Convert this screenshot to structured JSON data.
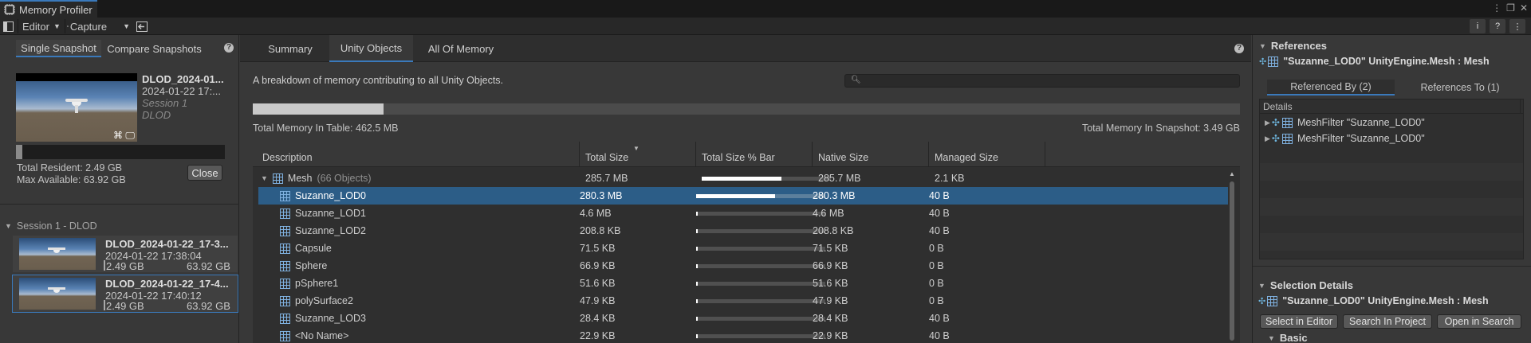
{
  "window": {
    "title": "Memory Profiler"
  },
  "toolbar": {
    "editor_label": "Editor",
    "capture_label": "Capture"
  },
  "left": {
    "tabs": [
      "Single Snapshot",
      "Compare Snapshots"
    ],
    "current": {
      "name": "DLOD_2024-01...",
      "date": "2024-01-22 17:...",
      "session": "Session 1",
      "project": "DLOD"
    },
    "total_resident": "Total Resident: 2.49 GB",
    "max_available": "Max Available: 63.92 GB",
    "close_label": "Close",
    "session_header": "Session 1 - DLOD",
    "snapshots": [
      {
        "name": "DLOD_2024-01-22_17-3...",
        "date": "2024-01-22 17:38:04",
        "resident": "2.49 GB",
        "max": "63.92 GB",
        "selected": false
      },
      {
        "name": "DLOD_2024-01-22_17-4...",
        "date": "2024-01-22 17:40:12",
        "resident": "2.49 GB",
        "max": "63.92 GB",
        "selected": true
      }
    ]
  },
  "center": {
    "tabs": [
      "Summary",
      "Unity Objects",
      "All Of Memory"
    ],
    "active_tab": "Unity Objects",
    "description": "A breakdown of memory contributing to all Unity Objects.",
    "search_placeholder": "",
    "total_in_table": "Total Memory In Table: 462.5 MB",
    "total_in_snapshot": "Total Memory In Snapshot: 3.49 GB",
    "table_fraction": 0.1325,
    "columns": [
      "Description",
      "Total Size",
      "Total Size % Bar",
      "Native Size",
      "Managed Size"
    ],
    "group": {
      "name": "Mesh",
      "count": "(66 Objects)",
      "total": "285.7 MB",
      "bar": 0.62,
      "native": "285.7 MB",
      "managed": "2.1 KB"
    },
    "rows": [
      {
        "name": "Suzanne_LOD0",
        "total": "280.3 MB",
        "bar": 0.61,
        "native": "280.3 MB",
        "managed": "40 B",
        "selected": true
      },
      {
        "name": "Suzanne_LOD1",
        "total": "4.6 MB",
        "bar": 0.012,
        "native": "4.6 MB",
        "managed": "40 B",
        "selected": false
      },
      {
        "name": "Suzanne_LOD2",
        "total": "208.8 KB",
        "bar": 0.006,
        "native": "208.8 KB",
        "managed": "40 B",
        "selected": false
      },
      {
        "name": "Capsule",
        "total": "71.5 KB",
        "bar": 0.006,
        "native": "71.5 KB",
        "managed": "0 B",
        "selected": false
      },
      {
        "name": "Sphere",
        "total": "66.9 KB",
        "bar": 0.006,
        "native": "66.9 KB",
        "managed": "0 B",
        "selected": false
      },
      {
        "name": "pSphere1",
        "total": "51.6 KB",
        "bar": 0.006,
        "native": "51.6 KB",
        "managed": "0 B",
        "selected": false
      },
      {
        "name": "polySurface2",
        "total": "47.9 KB",
        "bar": 0.006,
        "native": "47.9 KB",
        "managed": "0 B",
        "selected": false
      },
      {
        "name": "Suzanne_LOD3",
        "total": "28.4 KB",
        "bar": 0.006,
        "native": "28.4 KB",
        "managed": "40 B",
        "selected": false
      },
      {
        "name": "<No Name>",
        "total": "22.9 KB",
        "bar": 0.006,
        "native": "22.9 KB",
        "managed": "40 B",
        "selected": false
      }
    ]
  },
  "right": {
    "references_title": "References",
    "object_title": "\"Suzanne_LOD0\" UnityEngine.Mesh : Mesh",
    "ref_tabs": [
      "Referenced By (2)",
      "References To (1)"
    ],
    "details_header": "Details",
    "refs": [
      "MeshFilter \"Suzanne_LOD0\"",
      "MeshFilter \"Suzanne_LOD0\""
    ],
    "selection_title": "Selection Details",
    "selection_object": "\"Suzanne_LOD0\" UnityEngine.Mesh : Mesh",
    "buttons": [
      "Select in Editor",
      "Search In Project",
      "Open in Search"
    ],
    "basic_label": "Basic"
  },
  "colors": {
    "accent": "#3a79bb",
    "selection": "#2c5d87",
    "mesh_icon": "#7fb1e0"
  }
}
